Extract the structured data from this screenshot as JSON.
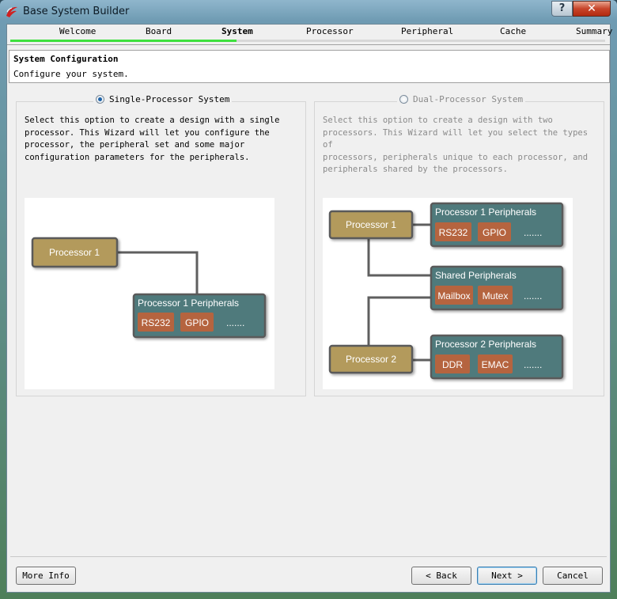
{
  "window": {
    "title": "Base System Builder",
    "help_label": "?",
    "close_label": "✕"
  },
  "steps": {
    "items": [
      "Welcome",
      "Board",
      "System",
      "Processor",
      "Peripheral",
      "Cache",
      "Summary"
    ],
    "active": "System",
    "progress": 0.38
  },
  "header": {
    "title": "System Configuration",
    "subtitle": "Configure your system."
  },
  "single": {
    "label": "Single-Processor System",
    "selected": true,
    "description": "Select this option to create a design with a single\nprocessor. This Wizard will let you configure the\nprocessor, the peripheral set and some major\nconfiguration parameters for the peripherals.",
    "diagram": {
      "processor": "Processor 1",
      "peripherals_title": "Processor 1 Peripherals",
      "chips": [
        "RS232",
        "GPIO"
      ],
      "more": "......."
    }
  },
  "dual": {
    "label": "Dual-Processor System",
    "selected": false,
    "description": "Select this option to create a design with two\nprocessors. This Wizard will let you select the types of\nprocessors, peripherals unique to each processor, and\nperipherals shared by the processors.",
    "diagram": {
      "processor1": "Processor 1",
      "processor2": "Processor 2",
      "p1_title": "Processor 1 Peripherals",
      "p1_chips": [
        "RS232",
        "GPIO"
      ],
      "shared_title": "Shared Peripherals",
      "shared_chips": [
        "Mailbox",
        "Mutex"
      ],
      "p2_title": "Processor 2 Peripherals",
      "p2_chips": [
        "DDR",
        "EMAC"
      ],
      "more": "......."
    }
  },
  "buttons": {
    "more_info": "More Info",
    "back": "< Back",
    "next": "Next >",
    "cancel": "Cancel"
  },
  "colors": {
    "processor_box": "#b39a5c",
    "peripheral_box": "#4f7a7b",
    "chip": "#b5643f",
    "connector": "#5f5f5f"
  }
}
